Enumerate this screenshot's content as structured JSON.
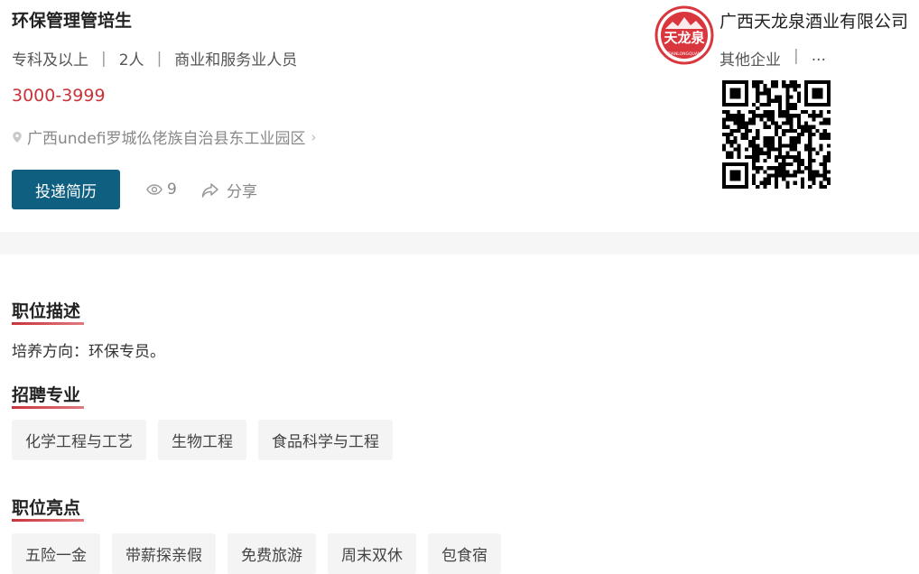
{
  "job": {
    "title": "环保管理管培生",
    "education": "专科及以上",
    "headcount": "2人",
    "category": "商业和服务业人员",
    "separator": "|",
    "salary": "3000-3999",
    "address": "广西undefi罗城仫佬族自治县东工业园区",
    "apply_label": "投递简历",
    "view_count": "9",
    "share_label": "分享"
  },
  "company": {
    "name": "广西天龙泉酒业有限公司",
    "logo_text": "天龙泉",
    "logo_subtext": "TIANLONGQUAN",
    "type": "其他企业",
    "extra": "...",
    "brand_color": "#d9363e"
  },
  "sections": {
    "description": {
      "heading": "职位描述",
      "text": "培养方向：环保专员。"
    },
    "majors": {
      "heading": "招聘专业",
      "tags": [
        "化学工程与工艺",
        "生物工程",
        "食品科学与工程"
      ]
    },
    "highlights": {
      "heading": "职位亮点",
      "tags": [
        "五险一金",
        "带薪探亲假",
        "免费旅游",
        "周末双休",
        "包食宿"
      ]
    }
  },
  "colors": {
    "accent": "#0e5f80",
    "salary": "#c8343a",
    "heading_underline": "#c8343a"
  }
}
